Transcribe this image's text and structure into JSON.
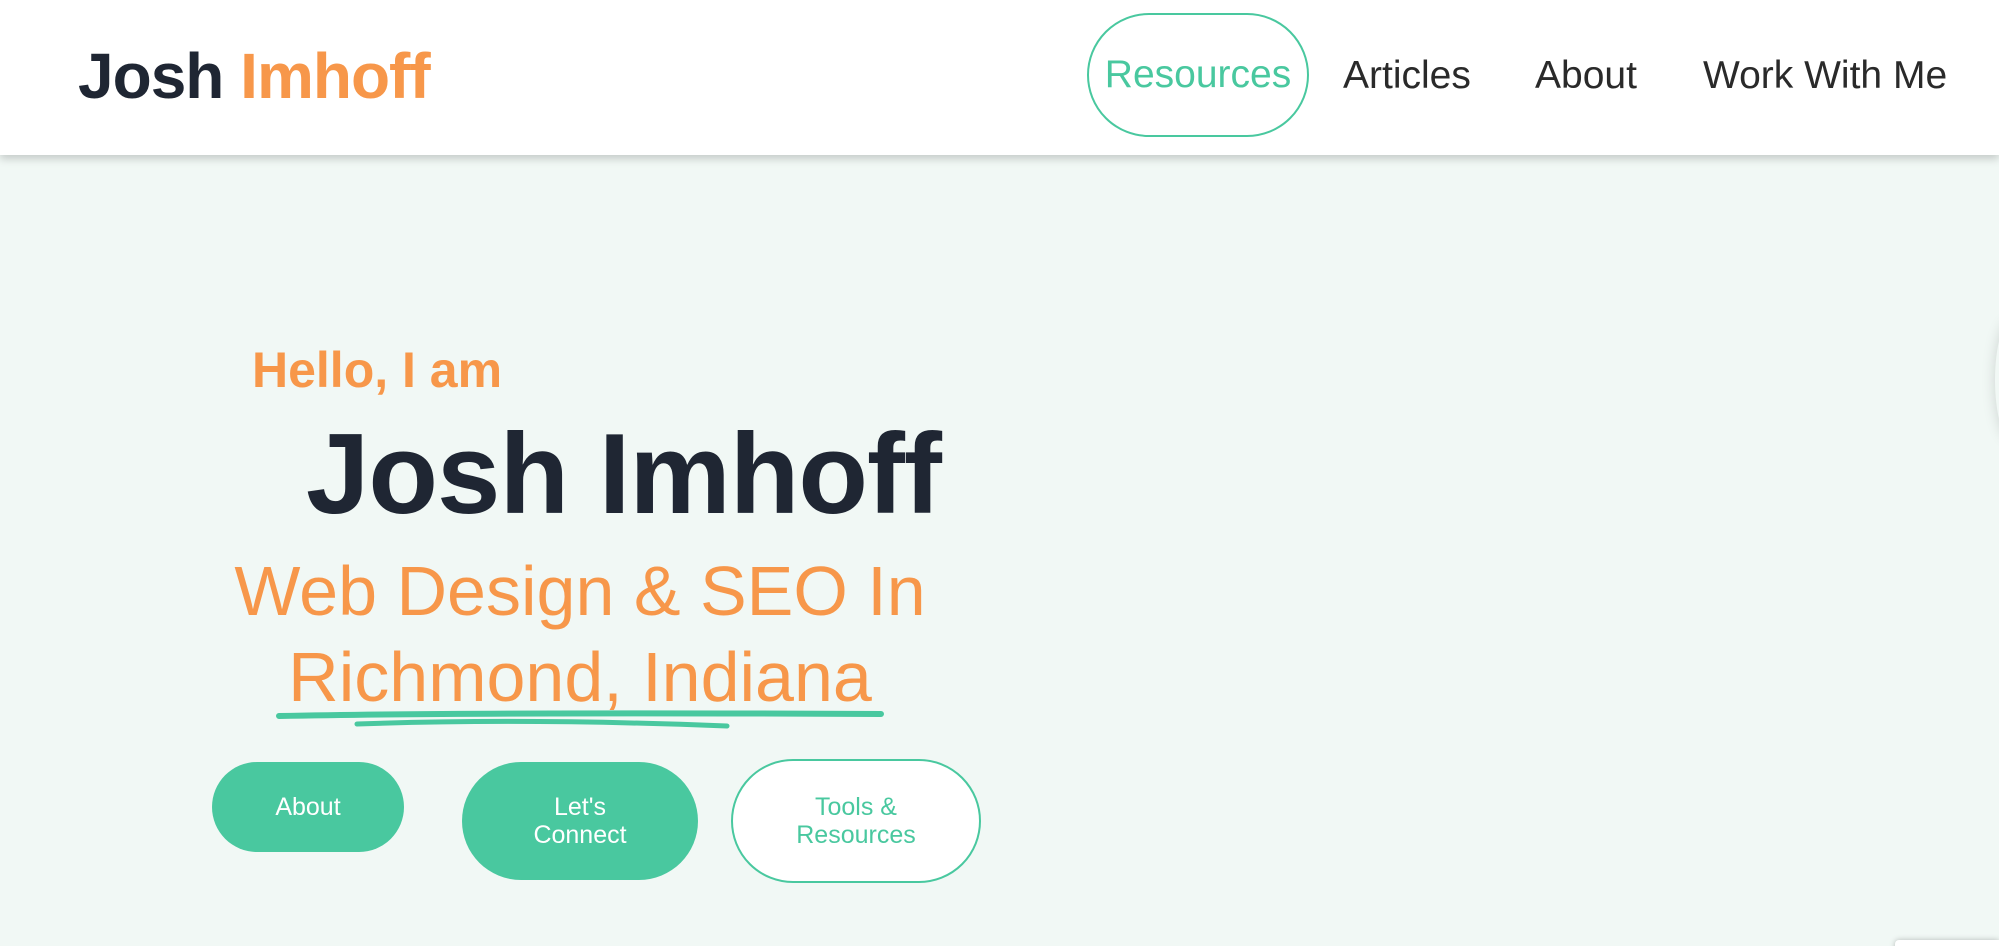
{
  "header": {
    "logo_first": "Josh",
    "logo_last": "Imhoff",
    "nav": {
      "resources": "Resources",
      "articles": "Articles",
      "about": "About",
      "work": "Work With Me"
    }
  },
  "hero": {
    "greeting": "Hello, I am",
    "name": "Josh Imhoff",
    "tagline_line1": "Web Design & SEO In",
    "tagline_line2": "Richmond, Indiana"
  },
  "buttons": {
    "about": "About",
    "connect_line1": "Let's",
    "connect_line2": "Connect",
    "tools_line1": "Tools &",
    "tools_line2": "Resources"
  },
  "colors": {
    "accent_green": "#49c89f",
    "accent_orange": "#f7974a",
    "dark_text": "#1f2633",
    "background": "#f1f8f5"
  }
}
